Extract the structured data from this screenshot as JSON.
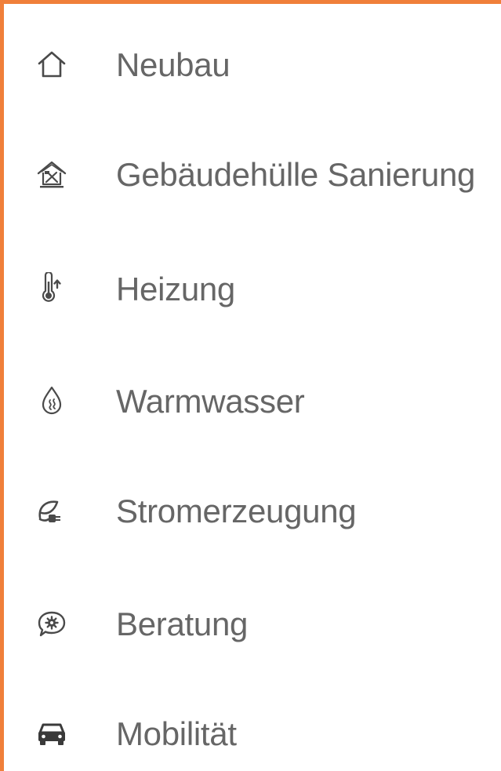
{
  "nav": {
    "accent_color": "#F07F3A",
    "text_color": "#666666",
    "icon_color": "#4A4A4A",
    "items": [
      {
        "label": "Neubau",
        "icon": "house-icon"
      },
      {
        "label": "Gebäudehülle Sanierung",
        "icon": "house-renovation-tools-icon"
      },
      {
        "label": "Heizung",
        "icon": "thermometer-up-icon"
      },
      {
        "label": "Warmwasser",
        "icon": "water-drop-steam-icon"
      },
      {
        "label": "Stromerzeugung",
        "icon": "leaf-plug-icon"
      },
      {
        "label": "Beratung",
        "icon": "speech-bubble-gear-icon"
      },
      {
        "label": "Mobilität",
        "icon": "car-icon"
      }
    ]
  }
}
